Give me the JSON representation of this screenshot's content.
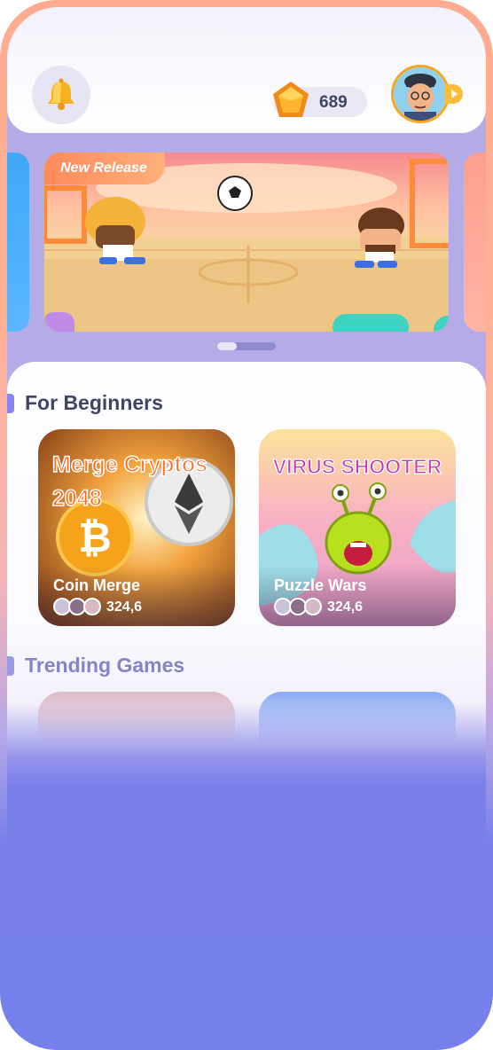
{
  "header": {
    "notification_icon": "bell-icon",
    "gems": {
      "icon": "gem-icon",
      "count": "689"
    },
    "profile": {
      "icon": "avatar",
      "arrow_icon": "chevron-right-icon"
    }
  },
  "banner": {
    "badge": "New Release",
    "carousel_dots": 2,
    "active_dot": 0
  },
  "sections": [
    {
      "title": "For Beginners",
      "games": [
        {
          "title": "Coin Merge",
          "players": "324,6",
          "art_text": [
            "Merge Cryptos",
            "2048"
          ]
        },
        {
          "title": "Puzzle Wars",
          "players": "324,6",
          "art_text": [
            "VIRUS SHOOTER"
          ]
        }
      ]
    },
    {
      "title": "Trending Games"
    }
  ],
  "colors": {
    "accent": "#8a84f0",
    "title_text": "#3f4567",
    "gem": "#f6a623",
    "bottom_bg": "#7580ea"
  }
}
